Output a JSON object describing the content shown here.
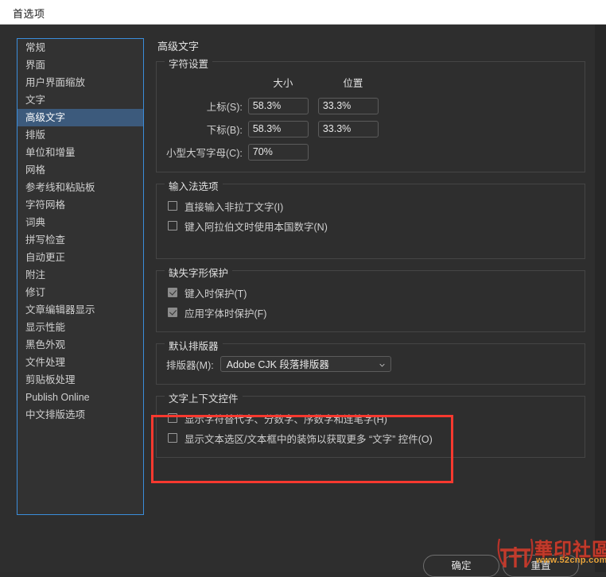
{
  "window": {
    "title": "首选项"
  },
  "sidebar": {
    "items": [
      {
        "label": "常规",
        "selected": false
      },
      {
        "label": "界面",
        "selected": false
      },
      {
        "label": "用户界面缩放",
        "selected": false
      },
      {
        "label": "文字",
        "selected": false
      },
      {
        "label": "高级文字",
        "selected": true
      },
      {
        "label": "排版",
        "selected": false
      },
      {
        "label": "单位和增量",
        "selected": false
      },
      {
        "label": "网格",
        "selected": false
      },
      {
        "label": "参考线和粘贴板",
        "selected": false
      },
      {
        "label": "字符网格",
        "selected": false
      },
      {
        "label": "词典",
        "selected": false
      },
      {
        "label": "拼写检查",
        "selected": false
      },
      {
        "label": "自动更正",
        "selected": false
      },
      {
        "label": "附注",
        "selected": false
      },
      {
        "label": "修订",
        "selected": false
      },
      {
        "label": "文章编辑器显示",
        "selected": false
      },
      {
        "label": "显示性能",
        "selected": false
      },
      {
        "label": "黑色外观",
        "selected": false
      },
      {
        "label": "文件处理",
        "selected": false
      },
      {
        "label": "剪贴板处理",
        "selected": false
      },
      {
        "label": "Publish Online",
        "selected": false
      },
      {
        "label": "中文排版选项",
        "selected": false
      }
    ]
  },
  "main": {
    "title": "高级文字",
    "character_settings": {
      "title": "字符设置",
      "col_size": "大小",
      "col_position": "位置",
      "rows": [
        {
          "label": "上标(S):",
          "size": "58.3%",
          "position": "33.3%"
        },
        {
          "label": "下标(B):",
          "size": "58.3%",
          "position": "33.3%"
        }
      ],
      "small_caps_label": "小型大写字母(C):",
      "small_caps_value": "70%"
    },
    "input_method": {
      "title": "输入法选项",
      "options": [
        {
          "label": "直接输入非拉丁文字(I)",
          "checked": false
        },
        {
          "label": "键入阿拉伯文时使用本国数字(N)",
          "checked": false
        }
      ]
    },
    "missing_glyph": {
      "title": "缺失字形保护",
      "options": [
        {
          "label": "键入时保护(T)",
          "checked": true
        },
        {
          "label": "应用字体时保护(F)",
          "checked": true
        }
      ]
    },
    "default_composer": {
      "title": "默认排版器",
      "label": "排版器(M):",
      "value": "Adobe CJK 段落排版器"
    },
    "text_context_controls": {
      "title": "文字上下文控件",
      "options": [
        {
          "label": "显示字符替代字、分数字、序数字和连笔字(H)",
          "checked": false
        },
        {
          "label": "显示文本选区/文本框中的装饰以获取更多 “文字” 控件(O)",
          "checked": false
        }
      ]
    }
  },
  "footer": {
    "ok_label": "确定",
    "reset_label": "重置"
  },
  "watermark": {
    "text": "華印社區",
    "url": "www.52cnp.com"
  },
  "colors": {
    "dialog_bg": "#2e2e2e",
    "titlebar_bg": "#ffffff",
    "selection_blue": "#3c5a7c",
    "focus_border": "#3a8ddb",
    "annotation_red": "#f8392f",
    "group_border": "#454545"
  }
}
